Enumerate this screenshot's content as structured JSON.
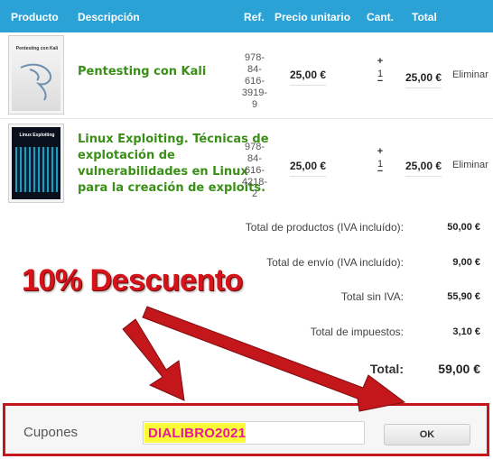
{
  "header": {
    "product": "Producto",
    "description": "Descripción",
    "ref": "Ref.",
    "unit_price": "Precio unitario",
    "qty": "Cant.",
    "total": "Total"
  },
  "items": [
    {
      "cover_title": "Pentesting con Kali",
      "title_lines": [
        "Pentesting con Kali"
      ],
      "isbn_lines": [
        "978-",
        "84-",
        "616-",
        "3919-9"
      ],
      "unit_price": "25,00 €",
      "qty_plus": "+",
      "qty": "1",
      "qty_minus": "−",
      "total": "25,00 €",
      "remove": "Eliminar"
    },
    {
      "cover_title": "Linux Exploiting",
      "title_lines": [
        "Linux Exploiting. Técnicas de",
        "explotación de",
        "vulnerabilidades en Linux",
        "para la creación de exploits."
      ],
      "isbn_lines": [
        "978-",
        "84-",
        "616-",
        "4218-2"
      ],
      "unit_price": "25,00 €",
      "qty_plus": "+",
      "qty": "1",
      "qty_minus": "−",
      "total": "25,00 €",
      "remove": "Eliminar"
    }
  ],
  "summary": {
    "products_label": "Total de productos (IVA incluído):",
    "products_value": "50,00 €",
    "shipping_label": "Total de envío (IVA incluído):",
    "shipping_value": "9,00 €",
    "no_vat_label": "Total sin IVA:",
    "no_vat_value": "55,90 €",
    "taxes_label": "Total de impuestos:",
    "taxes_value": "3,10 €",
    "total_label": "Total:",
    "total_value": "59,00 €"
  },
  "promo": {
    "discount_text": "10% Descuento"
  },
  "coupon": {
    "label": "Cupones",
    "code": "DIALIBRO2021",
    "ok_label": "OK"
  },
  "colors": {
    "header_bg": "#2aa2d6",
    "title_green": "#3a8f17",
    "annotation_red": "#c3171b",
    "code_magenta": "#e8189a",
    "code_highlight": "#fbfb3a"
  },
  "icons": {
    "arrow": "red-arrow-icon",
    "dragon": "kali-dragon-icon"
  }
}
